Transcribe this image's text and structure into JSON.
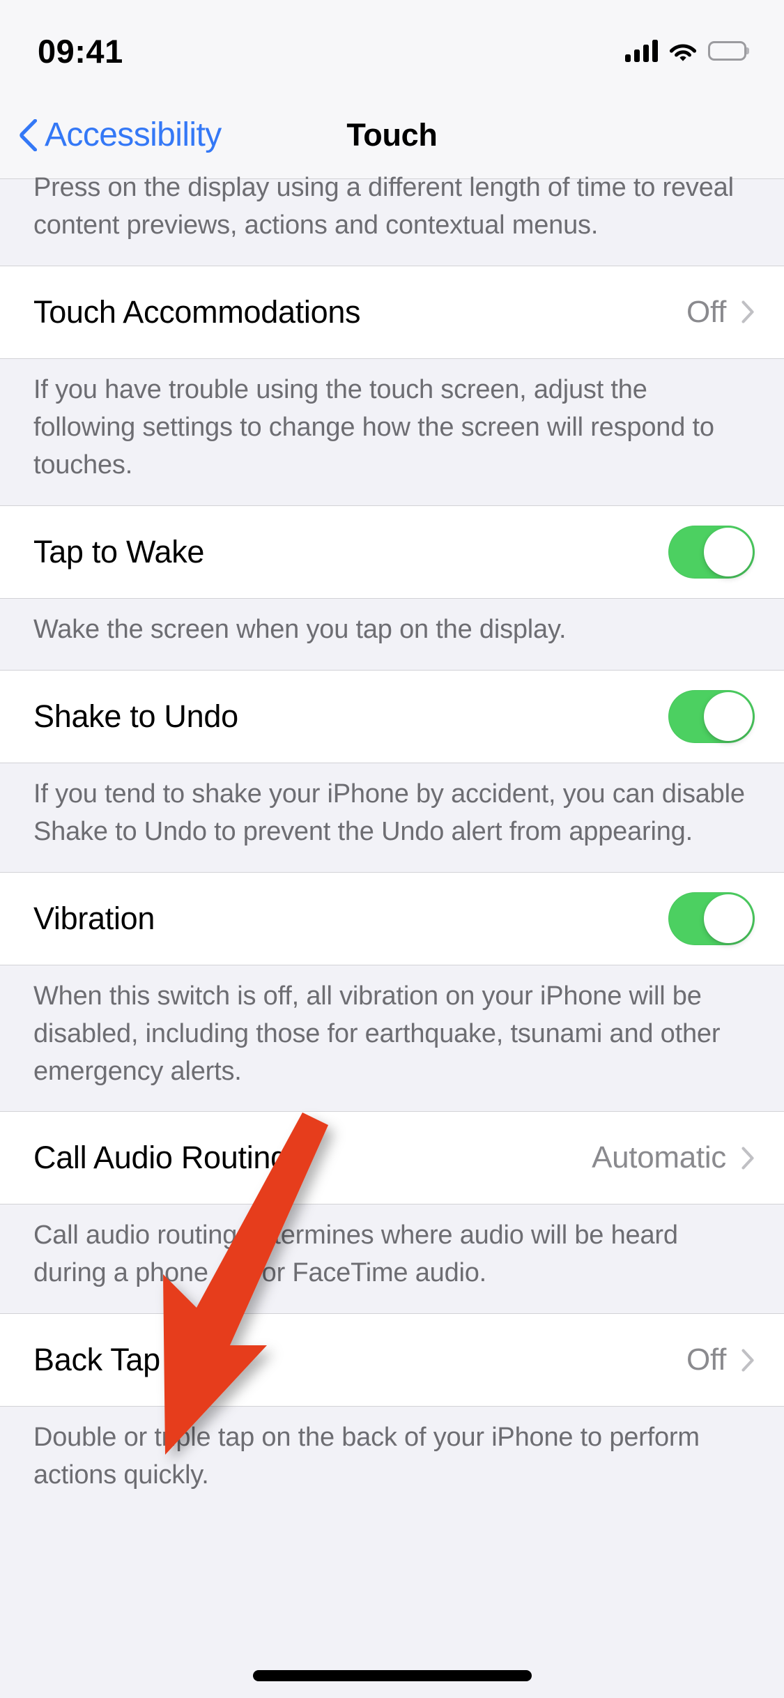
{
  "status_bar": {
    "time": "09:41",
    "cellular_icon": "cellular-bars-icon",
    "wifi_icon": "wifi-icon",
    "battery_icon": "battery-full-icon"
  },
  "nav_bar": {
    "back_label": "Accessibility",
    "back_icon": "chevron-left-icon",
    "title": "Touch"
  },
  "sections": [
    {
      "footer_only": true,
      "footer": "Press on the display using a different length of time to reveal content previews, actions and contextual menus."
    },
    {
      "row": {
        "title": "Touch Accommodations",
        "type": "disclosure",
        "value": "Off",
        "icon": "chevron-right-icon"
      },
      "footer": "If you have trouble using the touch screen, adjust the following settings to change how the screen will respond to touches."
    },
    {
      "row": {
        "title": "Tap to Wake",
        "type": "toggle",
        "value": "on"
      },
      "footer": "Wake the screen when you tap on the display."
    },
    {
      "row": {
        "title": "Shake to Undo",
        "type": "toggle",
        "value": "on"
      },
      "footer": "If you tend to shake your iPhone by accident, you can disable Shake to Undo to prevent the Undo alert from appearing."
    },
    {
      "row": {
        "title": "Vibration",
        "type": "toggle",
        "value": "on"
      },
      "footer": "When this switch is off, all vibration on your iPhone will be disabled, including those for earthquake, tsunami and other emergency alerts."
    },
    {
      "row": {
        "title": "Call Audio Routing",
        "type": "disclosure",
        "value": "Automatic",
        "icon": "chevron-right-icon"
      },
      "footer": "Call audio routing determines where audio will be heard during a phone call or FaceTime audio."
    },
    {
      "row": {
        "title": "Back Tap",
        "type": "disclosure",
        "value": "Off",
        "icon": "chevron-right-icon"
      },
      "footer": "Double or triple tap on the back of your iPhone to perform actions quickly."
    }
  ],
  "annotation": {
    "type": "arrow",
    "color": "#E63E1E",
    "points_to": "Back Tap"
  },
  "colors": {
    "accent_blue": "#3478F6",
    "toggle_on_green": "#4CD061",
    "group_background": "#F2F2F7",
    "cell_background": "#FFFFFF",
    "secondary_text": "#6D6D72",
    "value_text": "#8A8A8E",
    "annotation_red": "#E63E1E"
  },
  "home_indicator": "home-indicator"
}
